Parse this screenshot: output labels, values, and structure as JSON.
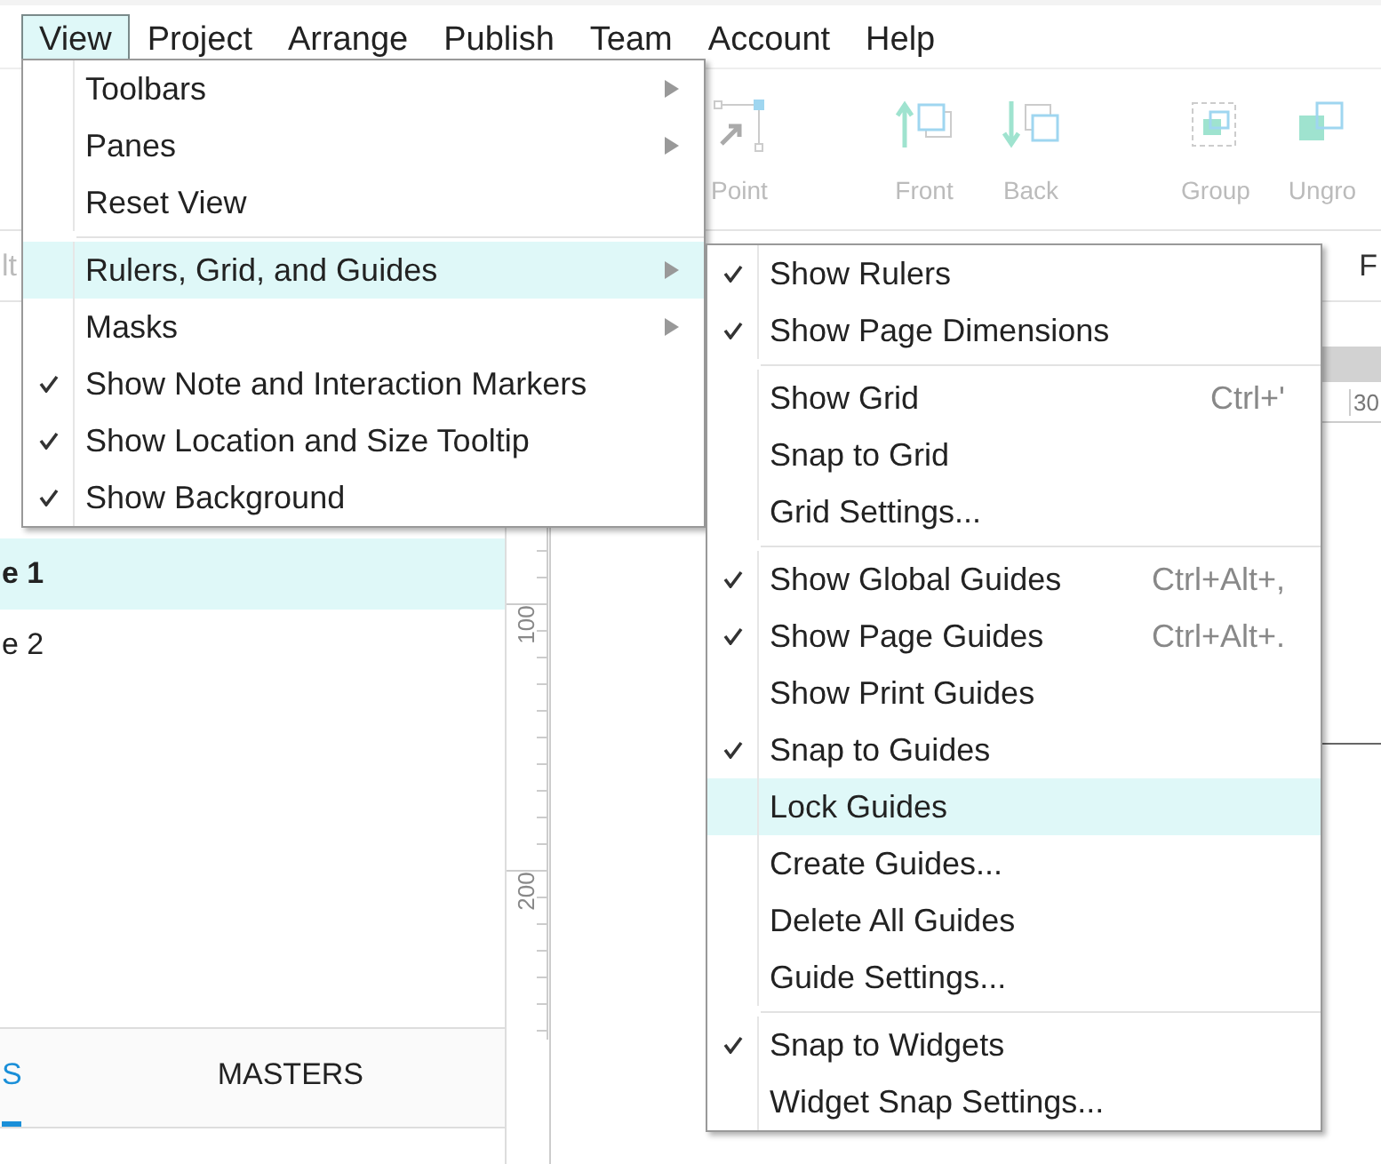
{
  "menubar": [
    {
      "label": "View",
      "selected": true
    },
    {
      "label": "Project",
      "selected": false
    },
    {
      "label": "Arrange",
      "selected": false
    },
    {
      "label": "Publish",
      "selected": false
    },
    {
      "label": "Team",
      "selected": false
    },
    {
      "label": "Account",
      "selected": false
    },
    {
      "label": "Help",
      "selected": false
    }
  ],
  "toolbar": {
    "groups": [
      [
        {
          "label": "Point",
          "kind": "point"
        }
      ],
      [
        {
          "label": "Front",
          "kind": "front"
        },
        {
          "label": "Back",
          "kind": "back"
        }
      ],
      [
        {
          "label": "Group",
          "kind": "group"
        },
        {
          "label": "Ungro",
          "kind": "ungroup"
        }
      ]
    ]
  },
  "subbar": {
    "left_text": "lt",
    "right_text": "F"
  },
  "pages": [
    {
      "label": "e 1",
      "selected": true
    },
    {
      "label": "e 2",
      "selected": false
    }
  ],
  "pane_tabs": [
    {
      "label": "S",
      "selected": true
    },
    {
      "label": "MASTERS",
      "selected": false
    }
  ],
  "rulers": {
    "horizontal": [
      "30"
    ],
    "vertical": [
      "100",
      "200"
    ]
  },
  "view_menu": [
    {
      "kind": "submenu",
      "label": "Toolbars",
      "checked": false,
      "selected": false
    },
    {
      "kind": "submenu",
      "label": "Panes",
      "checked": false,
      "selected": false
    },
    {
      "kind": "command",
      "label": "Reset View",
      "checked": false,
      "selected": false
    },
    {
      "kind": "separator"
    },
    {
      "kind": "submenu",
      "label": "Rulers, Grid, and Guides",
      "checked": false,
      "selected": true
    },
    {
      "kind": "submenu",
      "label": "Masks",
      "checked": false,
      "selected": false
    },
    {
      "kind": "command",
      "label": "Show Note and Interaction Markers",
      "checked": true,
      "selected": false
    },
    {
      "kind": "command",
      "label": "Show Location and Size Tooltip",
      "checked": true,
      "selected": false
    },
    {
      "kind": "command",
      "label": "Show Background",
      "checked": true,
      "selected": false
    }
  ],
  "guides_menu": [
    {
      "kind": "command",
      "label": "Show Rulers",
      "checked": true,
      "selected": false
    },
    {
      "kind": "command",
      "label": "Show Page Dimensions",
      "checked": true,
      "selected": false
    },
    {
      "kind": "separator"
    },
    {
      "kind": "command",
      "label": "Show Grid",
      "shortcut": "Ctrl+'",
      "checked": false,
      "selected": false
    },
    {
      "kind": "command",
      "label": "Snap to Grid",
      "checked": false,
      "selected": false
    },
    {
      "kind": "command",
      "label": "Grid Settings...",
      "checked": false,
      "selected": false
    },
    {
      "kind": "separator"
    },
    {
      "kind": "command",
      "label": "Show Global Guides",
      "shortcut": "Ctrl+Alt+,",
      "checked": true,
      "selected": false
    },
    {
      "kind": "command",
      "label": "Show Page Guides",
      "shortcut": "Ctrl+Alt+.",
      "checked": true,
      "selected": false
    },
    {
      "kind": "command",
      "label": "Show Print Guides",
      "checked": false,
      "selected": false
    },
    {
      "kind": "command",
      "label": "Snap to Guides",
      "checked": true,
      "selected": false
    },
    {
      "kind": "command",
      "label": "Lock Guides",
      "checked": false,
      "selected": true
    },
    {
      "kind": "command",
      "label": "Create Guides...",
      "checked": false,
      "selected": false
    },
    {
      "kind": "command",
      "label": "Delete All Guides",
      "checked": false,
      "selected": false
    },
    {
      "kind": "command",
      "label": "Guide Settings...",
      "checked": false,
      "selected": false
    },
    {
      "kind": "separator"
    },
    {
      "kind": "command",
      "label": "Snap to Widgets",
      "checked": true,
      "selected": false
    },
    {
      "kind": "command",
      "label": "Widget Snap Settings...",
      "checked": false,
      "selected": false
    }
  ]
}
